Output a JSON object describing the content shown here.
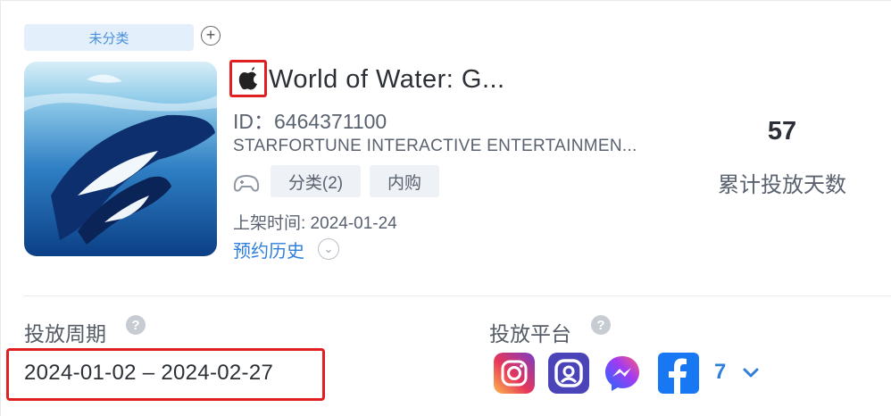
{
  "app": {
    "category_tag": "未分类",
    "title": "World of Water: G...",
    "id_text": "ID：6464371100",
    "publisher": "STARFORTUNE INTERACTIVE ENTERTAINMEN...",
    "platform_icon": "apple-icon",
    "tags": [
      {
        "label": "分类(2)"
      },
      {
        "label": "内购"
      }
    ],
    "release_text": "上架时间: 2024-01-24",
    "history_link": "预约历史"
  },
  "stats": {
    "days_value": "57",
    "days_label": "累计投放天数"
  },
  "period": {
    "label": "投放周期",
    "value": "2024-01-02 – 2024-02-27"
  },
  "platforms": {
    "label": "投放平台",
    "channels": [
      "instagram-icon",
      "rounded-app-icon",
      "messenger-icon",
      "facebook-icon"
    ],
    "more_count": "7"
  },
  "colors": {
    "highlight_border": "#e02020",
    "link_blue": "#2f7fdb",
    "tag_bg": "#e3effb"
  }
}
